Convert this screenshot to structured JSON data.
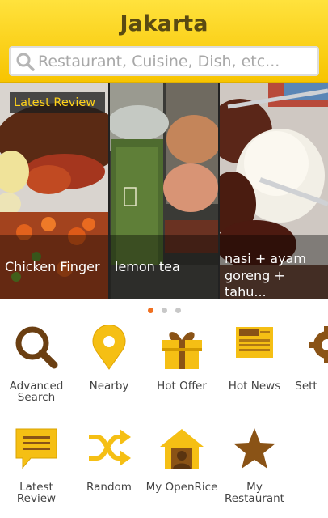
{
  "header": {
    "city": "Jakarta",
    "search_placeholder": "Restaurant, Cuisine, Dish, etc..."
  },
  "carousel": {
    "tag": "Latest Review",
    "cards": [
      {
        "label": "Chicken Finger"
      },
      {
        "label": "lemon tea"
      },
      {
        "label_line1": "nasi + ayam",
        "label_line2": "goreng + tahu..."
      }
    ],
    "page_count": 3,
    "active_page": 1
  },
  "menu": {
    "row1": [
      {
        "label_line1": "Advanced",
        "label_line2": "Search",
        "icon": "magnifier-icon"
      },
      {
        "label_line1": "Nearby",
        "label_line2": "",
        "icon": "location-pin-icon"
      },
      {
        "label_line1": "Hot Offer",
        "label_line2": "",
        "icon": "gift-icon"
      },
      {
        "label_line1": "Hot News",
        "label_line2": "",
        "icon": "newspaper-icon"
      },
      {
        "label_line1": "Sett",
        "label_line2": "",
        "icon": "gear-icon"
      }
    ],
    "row2": [
      {
        "label_line1": "Latest",
        "label_line2": "Review",
        "icon": "review-bubble-icon"
      },
      {
        "label_line1": "Random",
        "label_line2": "",
        "icon": "shuffle-icon"
      },
      {
        "label_line1": "My OpenRice",
        "label_line2": "",
        "icon": "home-user-icon"
      },
      {
        "label_line1": "My",
        "label_line2": "Restaurant",
        "icon": "star-icon"
      }
    ]
  },
  "colors": {
    "header_yellow": "#f7c400",
    "icon_brown": "#6b3f12",
    "icon_yellow": "#f5bf14",
    "dot_active": "#f07020"
  }
}
